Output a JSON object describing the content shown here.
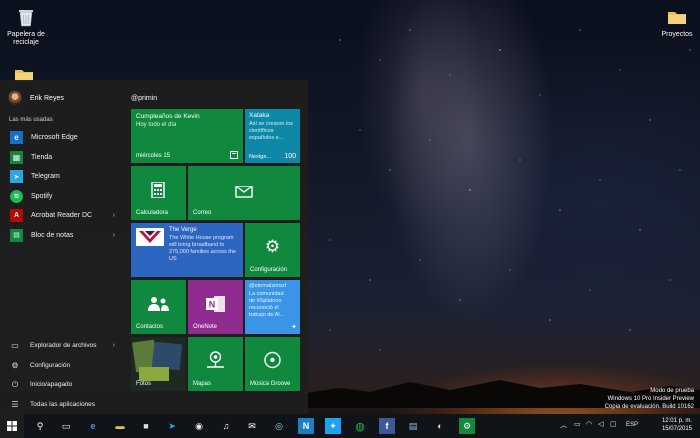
{
  "desktop": {
    "icons": [
      {
        "label": "Papelera de reciclaje",
        "icon": "recycle-bin-icon"
      },
      {
        "label": "Proyectos",
        "icon": "folder-icon"
      },
      {
        "label": "",
        "icon": "folder-icon"
      }
    ],
    "watermark": {
      "line1": "Modo de prueba",
      "line2": "Windows 10 Pro Insider Preview",
      "line3": "Copia de evaluación. Build 10162"
    }
  },
  "start_menu": {
    "user_name": "Erik Reyes",
    "most_used_label": "Las más usadas",
    "apps": [
      {
        "label": "Microsoft Edge",
        "icon": "edge-icon",
        "color": "#1570c7",
        "has_submenu": false
      },
      {
        "label": "Tienda",
        "icon": "store-icon",
        "color": "#10893e",
        "has_submenu": false
      },
      {
        "label": "Telegram",
        "icon": "telegram-icon",
        "color": "#2ca5e0",
        "has_submenu": false
      },
      {
        "label": "Spotify",
        "icon": "spotify-icon",
        "color": "#1db954",
        "has_submenu": false
      },
      {
        "label": "Acrobat Reader DC",
        "icon": "acrobat-icon",
        "color": "#b30b00",
        "has_submenu": true
      },
      {
        "label": "Bloc de notas",
        "icon": "notepad-icon",
        "color": "#10893e",
        "has_submenu": true
      }
    ],
    "system": [
      {
        "label": "Explorador de archivos",
        "icon": "folder-icon",
        "has_submenu": true
      },
      {
        "label": "Configuración",
        "icon": "gear-icon",
        "has_submenu": false
      },
      {
        "label": "Inicio/apagado",
        "icon": "power-icon",
        "has_submenu": false
      },
      {
        "label": "Todas las aplicaciones",
        "icon": "all-apps-icon",
        "has_submenu": false
      }
    ],
    "tiles_header": "@primin",
    "tiles": {
      "cumple": {
        "title": "Cumpleaños de Kevin",
        "sub": "Hoy todo el día",
        "date": "miércoles 15"
      },
      "xataka": {
        "title": "Xataka",
        "text": "Así se crearon los científicos españoles e...",
        "footer": "Nextge...",
        "count": "100"
      },
      "calculadora": "Calculadora",
      "correo": "Correo",
      "verge": {
        "title": "The Verge",
        "text": "The White House program will bring broadband to 275,000 families across the US"
      },
      "configuracion": "Configuración",
      "contactos": "Contactos",
      "onenote": "OneNote",
      "twitter": {
        "user": "@eternalsimsrf",
        "text": "La comunidad de #Splatoon reconoció el trabajo de Al..."
      },
      "fotos": "Fotos",
      "mapas": "Mapas",
      "musica": "Música Groove"
    }
  },
  "taskbar": {
    "apps": [
      {
        "icon": "search-icon",
        "glyph": "⚲"
      },
      {
        "icon": "task-view-icon",
        "glyph": "▭"
      },
      {
        "icon": "edge-icon",
        "glyph": "e"
      },
      {
        "icon": "file-explorer-icon",
        "glyph": "▬"
      },
      {
        "icon": "store-icon",
        "glyph": "■"
      },
      {
        "icon": "telegram-icon",
        "glyph": "➤"
      },
      {
        "icon": "chrome-icon",
        "glyph": "◉"
      },
      {
        "icon": "itunes-icon",
        "glyph": "♫"
      },
      {
        "icon": "mail-icon",
        "glyph": "✉"
      },
      {
        "icon": "media-icon",
        "glyph": "◎"
      },
      {
        "icon": "n-app-icon",
        "glyph": "N"
      },
      {
        "icon": "twitter-icon",
        "glyph": "✦"
      },
      {
        "icon": "spotify-icon",
        "glyph": "◍"
      },
      {
        "icon": "facebook-icon",
        "glyph": "f"
      },
      {
        "icon": "notepad-icon",
        "glyph": "▤"
      },
      {
        "icon": "paint-icon",
        "glyph": "◐"
      },
      {
        "icon": "settings-icon",
        "glyph": "⚙"
      }
    ],
    "language": "ESP",
    "time": "12:01 p. m.",
    "date": "15/07/2015"
  }
}
